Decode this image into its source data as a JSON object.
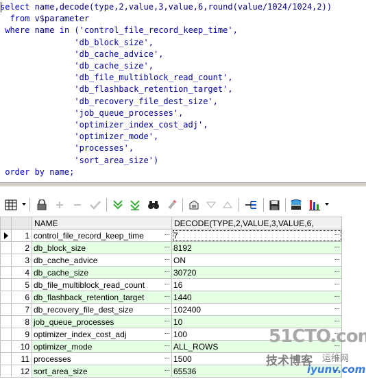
{
  "sql": {
    "line1_kw": "select",
    "line1_rest": " name,decode(type,2,value,3,value,6,round(value/1024/1024,2))",
    "line2_kw": "  from",
    "line2_rest": " v$parameter",
    "line3_kw": " where",
    "line3_mid": " name ",
    "line3_in": "in",
    "line3_rest": " ('control_file_record_keep_time',",
    "params": [
      "               'db_block_size',",
      "               'db_cache_advice',",
      "               'db_cache_size',",
      "               'db_file_multiblock_read_count',",
      "               'db_flashback_retention_target',",
      "               'db_recovery_file_dest_size',",
      "               'job_queue_processes',",
      "               'optimizer_index_cost_adj',",
      "               'optimizer_mode',",
      "               'processes',",
      "               'sort_area_size')"
    ],
    "line_last_kw": " order by",
    "line_last_rest": " name;"
  },
  "toolbar": {
    "icons": [
      "grid-view-icon",
      "lock-icon",
      "add-row-icon",
      "delete-row-icon",
      "post-icon",
      "query-by-example-icon",
      "clear-filter-icon",
      "find-icon",
      "clear-icon",
      "export-icon",
      "next-page-icon",
      "previous-page-icon",
      "chart-icon",
      "save-icon",
      "print-icon",
      "statistics-icon"
    ]
  },
  "grid": {
    "columns": [
      "NAME",
      "DECODE(TYPE,2,VALUE,3,VALUE,6,"
    ],
    "ellipsis": "...",
    "rows": [
      {
        "num": "1",
        "name": "control_file_record_keep_time",
        "value": "7"
      },
      {
        "num": "2",
        "name": "db_block_size",
        "value": "8192"
      },
      {
        "num": "3",
        "name": "db_cache_advice",
        "value": "ON"
      },
      {
        "num": "4",
        "name": "db_cache_size",
        "value": "30720"
      },
      {
        "num": "5",
        "name": "db_file_multiblock_read_count",
        "value": "16"
      },
      {
        "num": "6",
        "name": "db_flashback_retention_target",
        "value": "1440"
      },
      {
        "num": "7",
        "name": "db_recovery_file_dest_size",
        "value": "102400"
      },
      {
        "num": "8",
        "name": "job_queue_processes",
        "value": "10"
      },
      {
        "num": "9",
        "name": "optimizer_index_cost_adj",
        "value": "100"
      },
      {
        "num": "10",
        "name": "optimizer_mode",
        "value": "ALL_ROWS"
      },
      {
        "num": "11",
        "name": "processes",
        "value": "1500"
      },
      {
        "num": "12",
        "name": "sort_area_size",
        "value": "65536"
      }
    ]
  },
  "watermark": {
    "brand": "51CTO.com",
    "sub": "技术博客",
    "sub2": "运维网",
    "url": "iyunv.com"
  },
  "colors": {
    "keyword": "#0000c0",
    "identifier": "#000080",
    "row_alt": "#e4ffe4"
  }
}
